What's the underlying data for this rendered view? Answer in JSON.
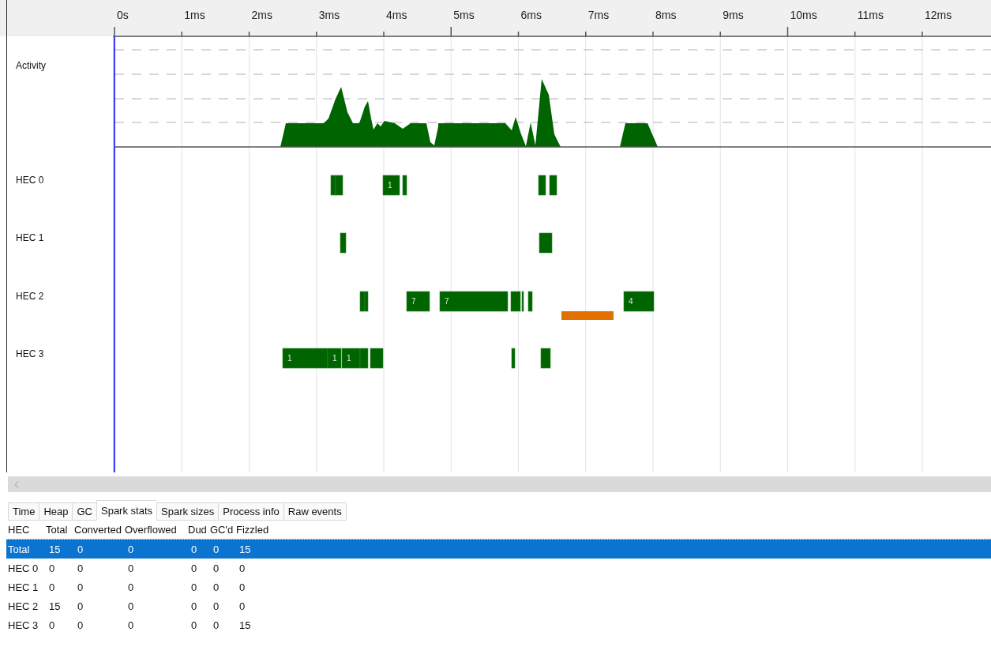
{
  "timeline": {
    "ticks": [
      "0s",
      "1ms",
      "2ms",
      "3ms",
      "4ms",
      "5ms",
      "6ms",
      "7ms",
      "8ms",
      "9ms",
      "10ms",
      "11ms",
      "12ms"
    ],
    "activity": {
      "label": "Activity"
    },
    "hecs": [
      {
        "label": "HEC 0",
        "bar_labels": [
          "1"
        ]
      },
      {
        "label": "HEC 1"
      },
      {
        "label": "HEC 2",
        "bar_labels": [
          "7",
          "7",
          "4"
        ]
      },
      {
        "label": "HEC 3",
        "bar_labels": [
          "1",
          "1",
          "1"
        ]
      }
    ]
  },
  "tabs": [
    {
      "label": "Time",
      "selected": false
    },
    {
      "label": "Heap",
      "selected": false
    },
    {
      "label": "GC",
      "selected": false
    },
    {
      "label": "Spark stats",
      "selected": true
    },
    {
      "label": "Spark sizes",
      "selected": false
    },
    {
      "label": "Process info",
      "selected": false
    },
    {
      "label": "Raw events",
      "selected": false
    }
  ],
  "spark_stats": {
    "columns": [
      "HEC",
      "Total",
      "Converted",
      "Overflowed",
      "Dud",
      "GC'd",
      "Fizzled"
    ],
    "rows": [
      {
        "cells": [
          "Total",
          "15",
          "0",
          "0",
          "0",
          "0",
          "15"
        ],
        "selected": true
      },
      {
        "cells": [
          "HEC 0",
          "0",
          "0",
          "0",
          "0",
          "0",
          "0"
        ],
        "selected": false
      },
      {
        "cells": [
          "HEC 1",
          "0",
          "0",
          "0",
          "0",
          "0",
          "0"
        ],
        "selected": false
      },
      {
        "cells": [
          "HEC 2",
          "15",
          "0",
          "0",
          "0",
          "0",
          "0"
        ],
        "selected": false
      },
      {
        "cells": [
          "HEC 3",
          "0",
          "0",
          "0",
          "0",
          "0",
          "15"
        ],
        "selected": false
      }
    ]
  }
}
